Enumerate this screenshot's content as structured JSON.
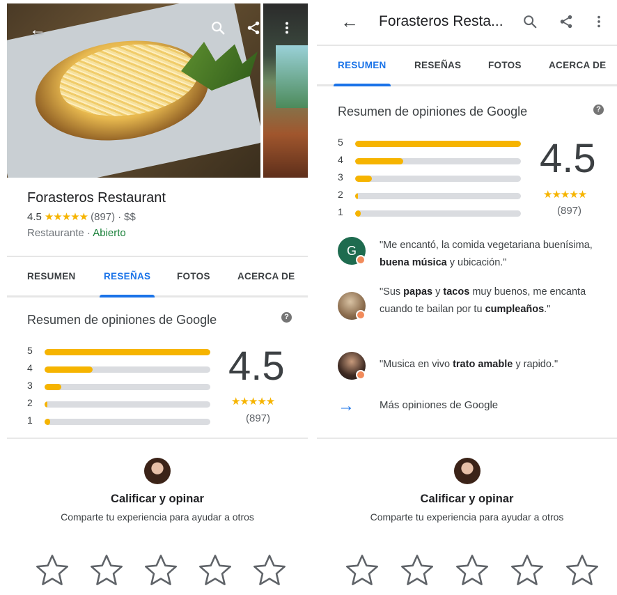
{
  "place": {
    "name": "Forasteros Restaurant",
    "short_title": "Forasteros Resta...",
    "rating": "4.5",
    "stars": "★★★★★",
    "count": "(897)",
    "dot": "·",
    "price": "$$",
    "category": "Restaurante",
    "status": "Abierto",
    "status_color": "#188038"
  },
  "tabs": [
    "RESUMEN",
    "RESEÑAS",
    "FOTOS",
    "ACERCA DE"
  ],
  "summary": {
    "title": "Resumen de opiniones de Google",
    "help": "?",
    "score": "4.5",
    "stars": "★★★★★",
    "count": "(897)",
    "distribution": [
      {
        "label": "5",
        "fraction": 1.0
      },
      {
        "label": "4",
        "fraction": 0.29
      },
      {
        "label": "3",
        "fraction": 0.1
      },
      {
        "label": "2",
        "fraction": 0.015
      },
      {
        "label": "1",
        "fraction": 0.035
      }
    ]
  },
  "snippets": [
    {
      "avatar": "G",
      "parts": [
        [
          "\"Me encantó, la comida vegetariana buenísima, ",
          false
        ],
        [
          "buena música",
          true
        ],
        [
          " y ubicación.\"",
          false
        ]
      ]
    },
    {
      "avatar": "",
      "parts": [
        [
          "\"Sus ",
          false
        ],
        [
          "papas",
          true
        ],
        [
          " y ",
          false
        ],
        [
          "tacos",
          true
        ],
        [
          " muy buenos, me encanta cuando te bailan por tu ",
          false
        ],
        [
          "cumpleaños",
          true
        ],
        [
          ".\"",
          false
        ]
      ]
    },
    {
      "avatar": "",
      "parts": [
        [
          "\"Musica en vivo ",
          false
        ],
        [
          "trato amable",
          true
        ],
        [
          " y rapido.\"",
          false
        ]
      ]
    }
  ],
  "more_reviews": "Más opiniones de Google",
  "rate": {
    "title": "Calificar y opinar",
    "subtitle": "Comparte tu experiencia para ayudar a otros",
    "star_count": 5
  },
  "icons": {
    "back": "arrow-left-icon",
    "search": "search-icon",
    "share": "share-icon",
    "more": "more-vert-icon",
    "arrow_right": "arrow-right-icon",
    "star": "star-outline-icon"
  },
  "colors": {
    "accent": "#1a73e8",
    "star": "#f6b400",
    "bar_track": "#dadce0"
  }
}
